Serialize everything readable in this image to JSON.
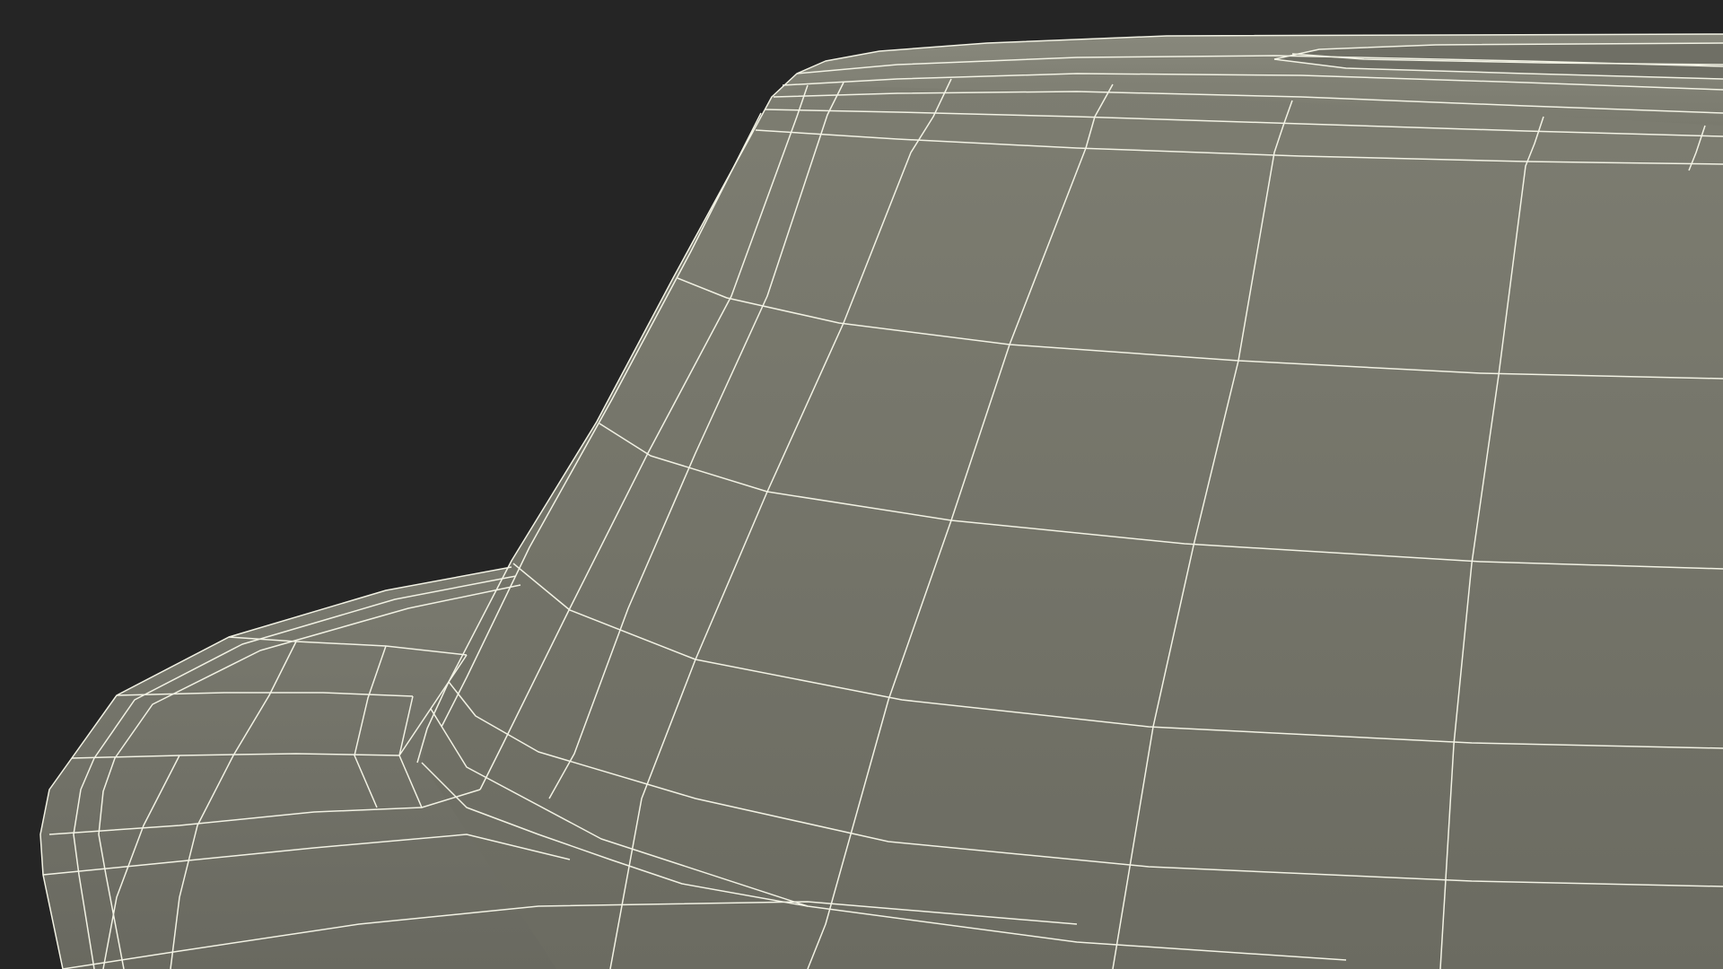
{
  "scene": {
    "subject": "wireframe-mesh",
    "colors": {
      "background": "#252525",
      "surface_light": "#7d7d72",
      "surface_dark": "#66665c",
      "wire": "#f2f2e4"
    }
  }
}
